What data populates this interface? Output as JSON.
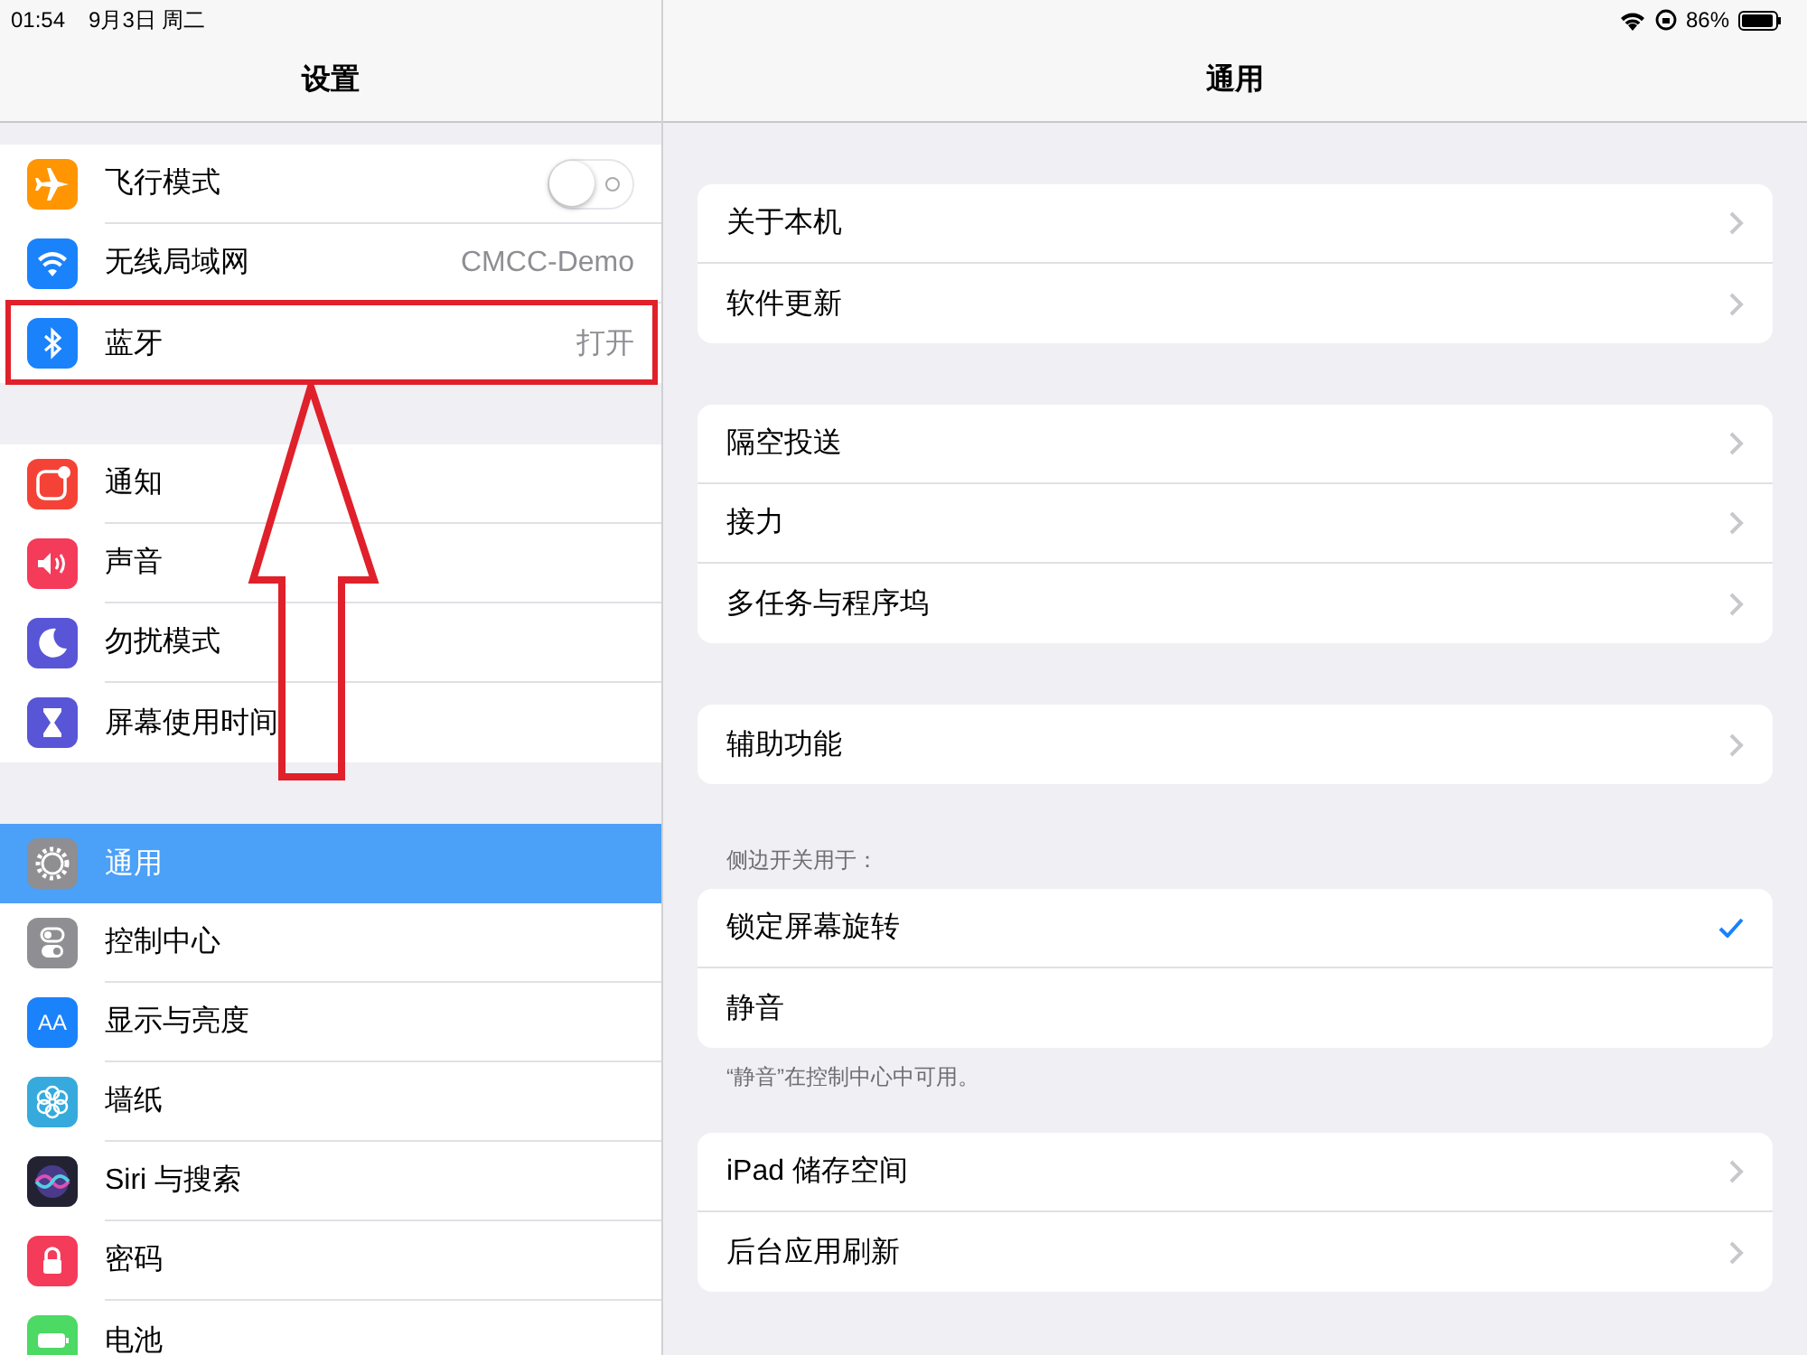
{
  "status_bar": {
    "time": "01:54",
    "date": "9月3日 周二",
    "battery": "86%"
  },
  "sidebar": {
    "title": "设置",
    "groups": [
      [
        {
          "label": "飞行模式",
          "kind": "toggle",
          "on": false,
          "selected": false,
          "color": "#ff9500"
        },
        {
          "label": "无线局域网",
          "kind": "value",
          "value": "CMCC-Demo",
          "selected": false,
          "color": "#1a82fb"
        },
        {
          "label": "蓝牙",
          "kind": "value",
          "value": "打开",
          "selected": false,
          "highlighted": true,
          "color": "#1a82fb"
        }
      ],
      [
        {
          "label": "通知",
          "kind": "plain",
          "selected": false,
          "color": "#f44336"
        },
        {
          "label": "声音",
          "kind": "plain",
          "selected": false,
          "color": "#f43b5a"
        },
        {
          "label": "勿扰模式",
          "kind": "plain",
          "selected": false,
          "color": "#5856d6"
        },
        {
          "label": "屏幕使用时间",
          "kind": "plain",
          "selected": false,
          "color": "#5856d6"
        }
      ],
      [
        {
          "label": "通用",
          "kind": "plain",
          "selected": true,
          "color": "#8e8e93"
        },
        {
          "label": "控制中心",
          "kind": "plain",
          "selected": false,
          "color": "#8e8e93"
        },
        {
          "label": "显示与亮度",
          "kind": "plain",
          "selected": false,
          "color": "#1a82fb",
          "icon_text": "AA"
        },
        {
          "label": "墙纸",
          "kind": "plain",
          "selected": false,
          "color": "#36aadc"
        },
        {
          "label": "Siri 与搜索",
          "kind": "plain",
          "selected": false,
          "color": "#222233"
        },
        {
          "label": "密码",
          "kind": "plain",
          "selected": false,
          "color": "#f43b5a"
        },
        {
          "label": "电池",
          "kind": "plain",
          "selected": false,
          "color": "#4cd964"
        }
      ]
    ]
  },
  "detail": {
    "title": "通用",
    "groups": [
      {
        "rows": [
          {
            "label": "关于本机",
            "kind": "link"
          },
          {
            "label": "软件更新",
            "kind": "link"
          }
        ]
      },
      {
        "rows": [
          {
            "label": "隔空投送",
            "kind": "link"
          },
          {
            "label": "接力",
            "kind": "link"
          },
          {
            "label": "多任务与程序坞",
            "kind": "link"
          }
        ]
      },
      {
        "rows": [
          {
            "label": "辅助功能",
            "kind": "link"
          }
        ]
      },
      {
        "header": "侧边开关用于：",
        "footer": "“静音”在控制中心中可用。",
        "rows": [
          {
            "label": "锁定屏幕旋转",
            "kind": "option",
            "selected": true
          },
          {
            "label": "静音",
            "kind": "option",
            "selected": false
          }
        ]
      },
      {
        "rows": [
          {
            "label": "iPad 储存空间",
            "kind": "link"
          },
          {
            "label": "后台应用刷新",
            "kind": "link"
          }
        ]
      }
    ]
  }
}
